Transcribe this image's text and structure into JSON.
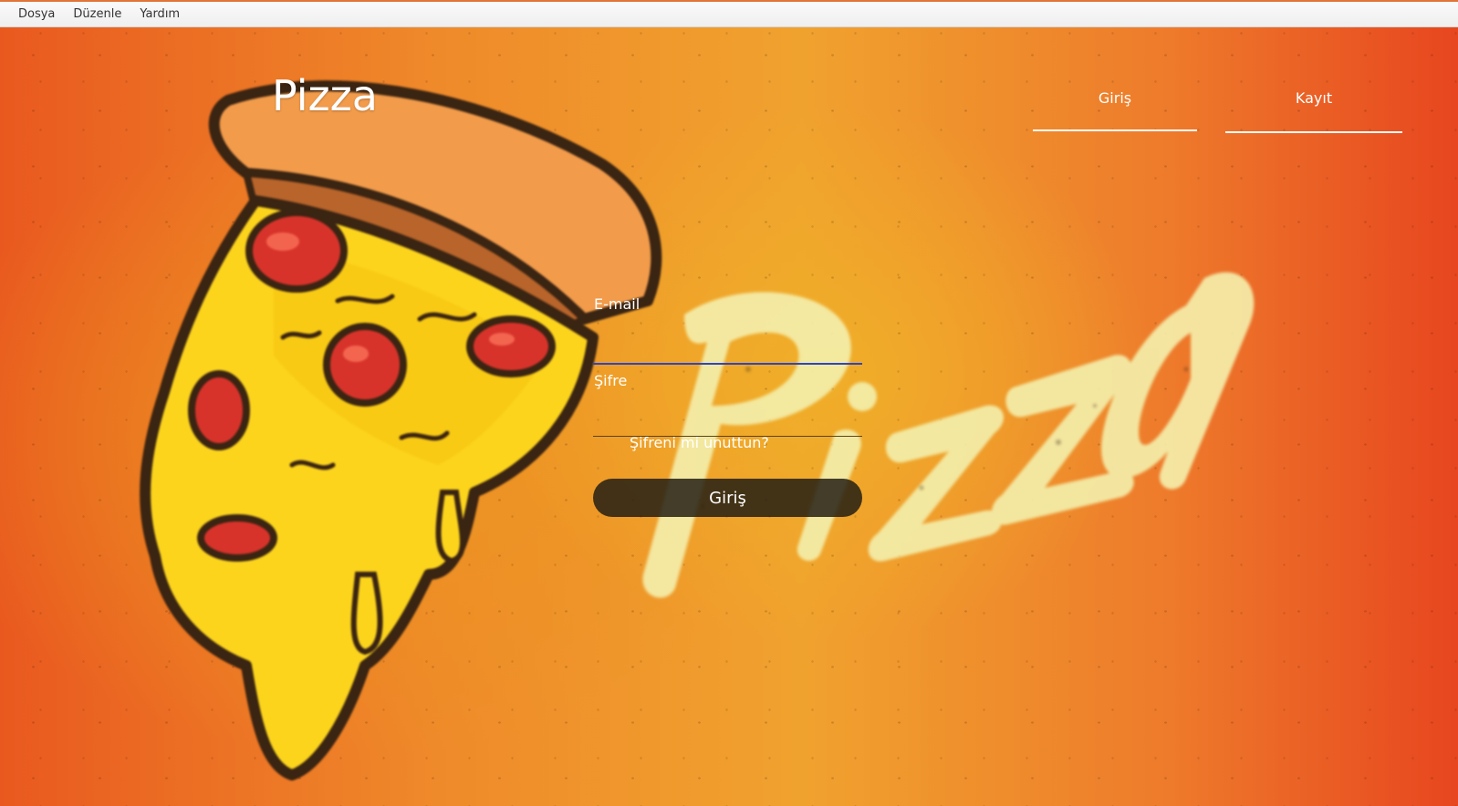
{
  "menubar": {
    "items": [
      {
        "label": "Dosya"
      },
      {
        "label": "Düzenle"
      },
      {
        "label": "Yardım"
      }
    ]
  },
  "app": {
    "title": "Pizza"
  },
  "tabs": {
    "login": "Giriş",
    "register": "Kayıt"
  },
  "form": {
    "email_label": "E-mail",
    "email_value": "",
    "password_label": "Şifre",
    "password_value": "",
    "forgot_link": "Şifreni mi unuttun?",
    "submit_label": "Giriş"
  },
  "colors": {
    "background_left": "#e9591f",
    "background_center": "#f0a22e",
    "background_right": "#e7461f",
    "email_focus_line": "#2c45c8",
    "button_bg": "#231e14"
  }
}
